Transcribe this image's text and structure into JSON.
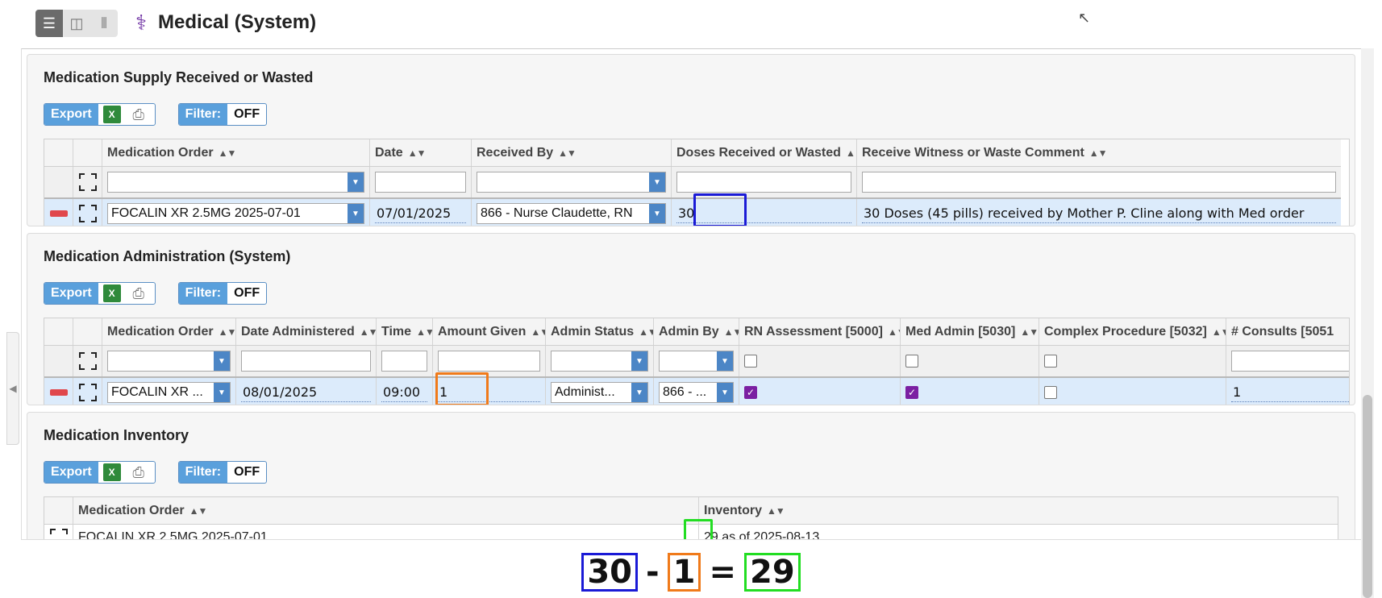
{
  "header": {
    "title": "Medical (System)",
    "app_icon": "stethoscope-icon"
  },
  "toolbar": {
    "export_label": "Export",
    "filter_label": "Filter:",
    "filter_value": "OFF"
  },
  "supply": {
    "title": "Medication Supply Received or Wasted",
    "columns": [
      "Medication Order",
      "Date",
      "Received By",
      "Doses Received or Wasted",
      "Receive Witness or Waste Comment"
    ],
    "row": {
      "medication_order": "FOCALIN XR 2.5MG 2025-07-01",
      "date": "07/01/2025",
      "received_by": "866 - Nurse Claudette, RN",
      "doses": "30",
      "comment": "30 Doses (45 pills) received by Mother P. Cline along with Med order"
    }
  },
  "admin": {
    "title": "Medication Administration (System)",
    "columns": [
      "Medication Order",
      "Date Administered",
      "Time",
      "Amount Given",
      "Admin Status",
      "Admin By",
      "RN Assessment [5000]",
      "Med Admin [5030]",
      "Complex Procedure [5032]",
      "# Consults [5051"
    ],
    "row": {
      "medication_order": "FOCALIN XR ...",
      "date": "08/01/2025",
      "time": "09:00",
      "amount": "1",
      "status": "Administ...",
      "admin_by": "866 - ...",
      "rn_assessment": true,
      "med_admin": true,
      "complex_procedure": false,
      "consults": "1"
    }
  },
  "inventory": {
    "title": "Medication Inventory",
    "columns": [
      "Medication Order",
      "Inventory"
    ],
    "row": {
      "medication_order": "FOCALIN XR 2.5MG 2025-07-01",
      "inventory_value": "29",
      "inventory_suffix": "as of 2025-08-13"
    }
  },
  "equation": {
    "a": "30",
    "op1": "-",
    "b": "1",
    "op2": "=",
    "c": "29"
  },
  "colors": {
    "blue": "#1a1ad6",
    "orange": "#f07a1a",
    "green": "#22dd22",
    "accent": "#5aa0dc",
    "checkbox": "#7b1fa2"
  }
}
